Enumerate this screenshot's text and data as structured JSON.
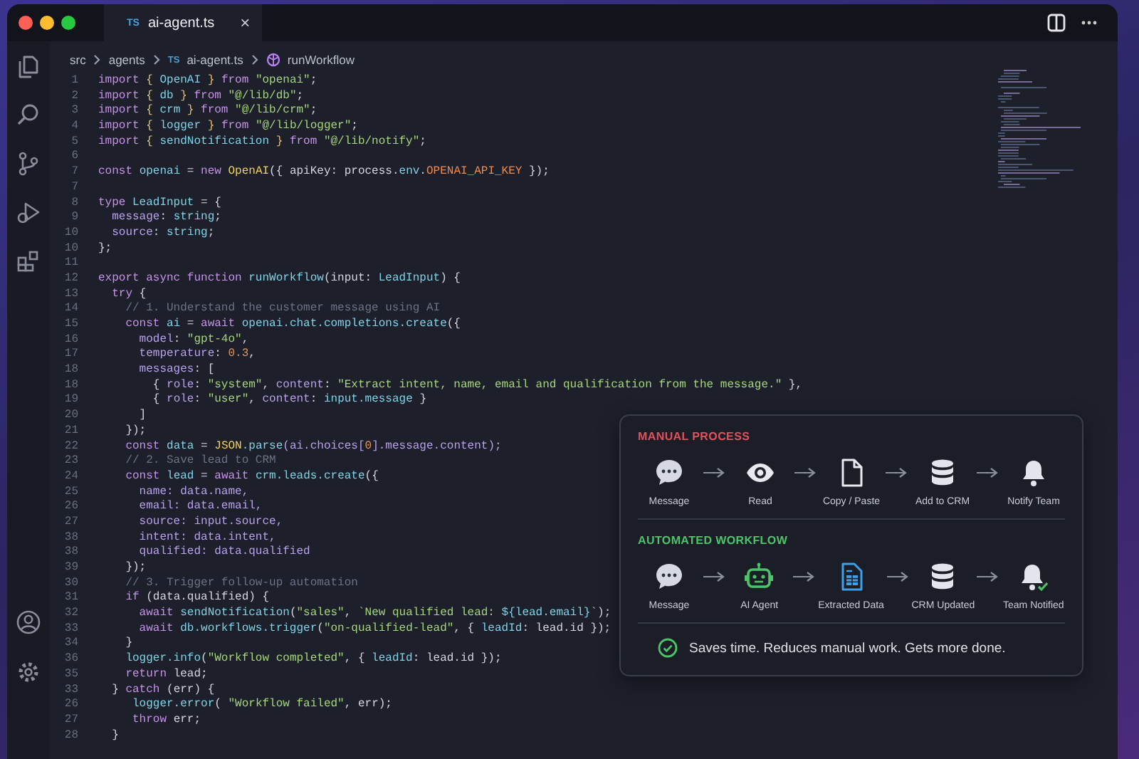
{
  "tab": {
    "badge": "TS",
    "title": "ai-agent.ts",
    "close": "×"
  },
  "breadcrumb": [
    {
      "kind": "folder",
      "label": "src"
    },
    {
      "kind": "folder",
      "label": "agents"
    },
    {
      "kind": "file",
      "badge": "TS",
      "label": "ai-agent.ts"
    },
    {
      "kind": "symbol",
      "label": "runWorkflow"
    }
  ],
  "code": [
    {
      "n": "1",
      "tokens": [
        {
          "t": "import",
          "kind": "kw"
        },
        {
          "t": " { ",
          "kind": "br"
        },
        {
          "t": "OpenAI",
          "kind": "id"
        },
        {
          "t": " } ",
          "kind": "br"
        },
        {
          "t": "from",
          "kind": "kw"
        },
        {
          "t": " \"openai\"",
          "kind": "str"
        },
        {
          "t": ";",
          "kind": "p"
        }
      ]
    },
    {
      "n": "2",
      "tokens": [
        {
          "t": "import",
          "kind": "kw"
        },
        {
          "t": " { ",
          "kind": "br"
        },
        {
          "t": "db",
          "kind": "id"
        },
        {
          "t": " } ",
          "kind": "br"
        },
        {
          "t": "from",
          "kind": "kw"
        },
        {
          "t": " \"@/lib/db\"",
          "kind": "str"
        },
        {
          "t": ";",
          "kind": "p"
        }
      ]
    },
    {
      "n": "3",
      "tokens": [
        {
          "t": "import",
          "kind": "kw"
        },
        {
          "t": " { ",
          "kind": "br"
        },
        {
          "t": "crm",
          "kind": "id"
        },
        {
          "t": " } ",
          "kind": "br"
        },
        {
          "t": "from",
          "kind": "kw"
        },
        {
          "t": " \"@/lib/crm\"",
          "kind": "str"
        },
        {
          "t": ";",
          "kind": "p"
        }
      ]
    },
    {
      "n": "4",
      "tokens": [
        {
          "t": "import",
          "kind": "kw"
        },
        {
          "t": " { ",
          "kind": "br"
        },
        {
          "t": "logger",
          "kind": "id"
        },
        {
          "t": " } ",
          "kind": "br"
        },
        {
          "t": "from",
          "kind": "kw"
        },
        {
          "t": " \"@/lib/logger\"",
          "kind": "str"
        },
        {
          "t": ";",
          "kind": "p"
        }
      ]
    },
    {
      "n": "5",
      "tokens": [
        {
          "t": "import",
          "kind": "kw"
        },
        {
          "t": " { ",
          "kind": "br"
        },
        {
          "t": "sendNotification",
          "kind": "id"
        },
        {
          "t": " } ",
          "kind": "br"
        },
        {
          "t": "from",
          "kind": "kw"
        },
        {
          "t": " \"@/lib/notify\"",
          "kind": "str"
        },
        {
          "t": ";",
          "kind": "p"
        }
      ]
    },
    {
      "n": "6"
    },
    {
      "n": "7",
      "tokens": [
        {
          "t": "const",
          "kind": "kw"
        },
        {
          "t": " openai",
          "kind": "id"
        },
        {
          "t": " = ",
          "kind": "p"
        },
        {
          "t": "new",
          "kind": "kw"
        },
        {
          "t": " OpenAI",
          "kind": "cls"
        },
        {
          "t": "({ apiKey: process.",
          "kind": "p"
        },
        {
          "t": "env",
          "kind": "id"
        },
        {
          "t": ".",
          "kind": "p"
        },
        {
          "t": "OPENAI_API_KEY",
          "kind": "cn"
        },
        {
          "t": " });",
          "kind": "p"
        }
      ]
    },
    {
      "n": "7"
    },
    {
      "n": "8",
      "tokens": [
        {
          "t": "type",
          "kind": "kw"
        },
        {
          "t": " LeadInput",
          "kind": "id"
        },
        {
          "t": " = {",
          "kind": "p"
        }
      ]
    },
    {
      "n": "9",
      "tokens": [
        {
          "t": "  message",
          "kind": "prop"
        },
        {
          "t": ": ",
          "kind": "p"
        },
        {
          "t": "string",
          "kind": "id"
        },
        {
          "t": ";",
          "kind": "p"
        }
      ]
    },
    {
      "n": "10",
      "tokens": [
        {
          "t": "  source",
          "kind": "prop"
        },
        {
          "t": ": ",
          "kind": "p"
        },
        {
          "t": "string",
          "kind": "id"
        },
        {
          "t": ";",
          "kind": "p"
        }
      ]
    },
    {
      "n": "10",
      "tokens": [
        {
          "t": "};",
          "kind": "p"
        }
      ]
    },
    {
      "n": "11"
    },
    {
      "n": "12",
      "tokens": [
        {
          "t": "export async function",
          "kind": "kw"
        },
        {
          "t": " runWorkflow",
          "kind": "id"
        },
        {
          "t": "(input: ",
          "kind": "p"
        },
        {
          "t": "LeadInput",
          "kind": "id"
        },
        {
          "t": ") {",
          "kind": "p"
        }
      ]
    },
    {
      "n": "13",
      "tokens": [
        {
          "t": "  try",
          "kind": "kw"
        },
        {
          "t": " {",
          "kind": "p"
        }
      ]
    },
    {
      "n": "14",
      "tokens": [
        {
          "t": "    // 1. Understand the customer message using AI",
          "kind": "com"
        }
      ]
    },
    {
      "n": "15",
      "tokens": [
        {
          "t": "    const",
          "kind": "kw"
        },
        {
          "t": " ai",
          "kind": "id"
        },
        {
          "t": " = ",
          "kind": "p"
        },
        {
          "t": "await",
          "kind": "kw"
        },
        {
          "t": " openai.chat.completions.create",
          "kind": "id"
        },
        {
          "t": "({",
          "kind": "p"
        }
      ]
    },
    {
      "n": "16",
      "tokens": [
        {
          "t": "      model",
          "kind": "prop"
        },
        {
          "t": ": ",
          "kind": "p"
        },
        {
          "t": "\"gpt-4o\"",
          "kind": "str"
        },
        {
          "t": ",",
          "kind": "p"
        }
      ]
    },
    {
      "n": "17",
      "tokens": [
        {
          "t": "      temperature",
          "kind": "prop"
        },
        {
          "t": ": ",
          "kind": "p"
        },
        {
          "t": "0.3",
          "kind": "num"
        },
        {
          "t": ",",
          "kind": "p"
        }
      ]
    },
    {
      "n": "18",
      "tokens": [
        {
          "t": "      messages",
          "kind": "prop"
        },
        {
          "t": ": [",
          "kind": "p"
        }
      ]
    },
    {
      "n": "18",
      "tokens": [
        {
          "t": "        { ",
          "kind": "p"
        },
        {
          "t": "role",
          "kind": "prop"
        },
        {
          "t": ": ",
          "kind": "p"
        },
        {
          "t": "\"system\"",
          "kind": "str"
        },
        {
          "t": ", ",
          "kind": "p"
        },
        {
          "t": "content",
          "kind": "prop"
        },
        {
          "t": ": ",
          "kind": "p"
        },
        {
          "t": "\"Extract intent, name, email and qualification from the message.\"",
          "kind": "str"
        },
        {
          "t": " },",
          "kind": "p"
        }
      ]
    },
    {
      "n": "19",
      "tokens": [
        {
          "t": "        { ",
          "kind": "p"
        },
        {
          "t": "role",
          "kind": "prop"
        },
        {
          "t": ": ",
          "kind": "p"
        },
        {
          "t": "\"user\"",
          "kind": "str"
        },
        {
          "t": ", ",
          "kind": "p"
        },
        {
          "t": "content",
          "kind": "prop"
        },
        {
          "t": ": ",
          "kind": "p"
        },
        {
          "t": "input.message",
          "kind": "id"
        },
        {
          "t": " }",
          "kind": "p"
        }
      ]
    },
    {
      "n": "20",
      "tokens": [
        {
          "t": "      ]",
          "kind": "p"
        }
      ]
    },
    {
      "n": "21",
      "tokens": [
        {
          "t": "    });",
          "kind": "p"
        }
      ]
    },
    {
      "n": "22",
      "tokens": [
        {
          "t": "    const",
          "kind": "kw"
        },
        {
          "t": " data",
          "kind": "id"
        },
        {
          "t": " = ",
          "kind": "p"
        },
        {
          "t": "JSON",
          "kind": "cls"
        },
        {
          "t": ".parse",
          "kind": "id"
        },
        {
          "t": "(ai.choices[",
          "kind": "prop"
        },
        {
          "t": "0",
          "kind": "num"
        },
        {
          "t": "].message.content);",
          "kind": "prop"
        }
      ]
    },
    {
      "n": "23",
      "tokens": [
        {
          "t": "    // 2. Save lead to CRM",
          "kind": "com"
        }
      ]
    },
    {
      "n": "24",
      "tokens": [
        {
          "t": "    const",
          "kind": "kw"
        },
        {
          "t": " lead",
          "kind": "id"
        },
        {
          "t": " = ",
          "kind": "p"
        },
        {
          "t": "await",
          "kind": "kw"
        },
        {
          "t": " crm.leads.create",
          "kind": "id"
        },
        {
          "t": "({",
          "kind": "p"
        }
      ]
    },
    {
      "n": "25",
      "tokens": [
        {
          "t": "      name",
          "kind": "prop"
        },
        {
          "t": ": data.name,",
          "kind": "prop"
        }
      ]
    },
    {
      "n": "26",
      "tokens": [
        {
          "t": "      email",
          "kind": "prop"
        },
        {
          "t": ": data.email,",
          "kind": "prop"
        }
      ]
    },
    {
      "n": "27",
      "tokens": [
        {
          "t": "      source",
          "kind": "prop"
        },
        {
          "t": ": input.source,",
          "kind": "prop"
        }
      ]
    },
    {
      "n": "38",
      "tokens": [
        {
          "t": "      intent",
          "kind": "prop"
        },
        {
          "t": ": data.intent,",
          "kind": "prop"
        }
      ]
    },
    {
      "n": "38",
      "tokens": [
        {
          "t": "      qualified",
          "kind": "prop"
        },
        {
          "t": ": data.qualified",
          "kind": "prop"
        }
      ]
    },
    {
      "n": "39",
      "tokens": [
        {
          "t": "    });",
          "kind": "p"
        }
      ]
    },
    {
      "n": "30",
      "tokens": [
        {
          "t": "    // 3. Trigger follow-up automation",
          "kind": "com"
        }
      ]
    },
    {
      "n": "31",
      "tokens": [
        {
          "t": "    if",
          "kind": "kw"
        },
        {
          "t": " (data.qualified) {",
          "kind": "p"
        }
      ]
    },
    {
      "n": "32",
      "tokens": [
        {
          "t": "      await",
          "kind": "kw"
        },
        {
          "t": " sendNotification",
          "kind": "id"
        },
        {
          "t": "(",
          "kind": "p"
        },
        {
          "t": "\"sales\"",
          "kind": "str"
        },
        {
          "t": ", ",
          "kind": "p"
        },
        {
          "t": "`New qualified lead: ",
          "kind": "str"
        },
        {
          "t": "${lead.email}",
          "kind": "id"
        },
        {
          "t": "`);",
          "kind": "p"
        }
      ]
    },
    {
      "n": "33",
      "tokens": [
        {
          "t": "      await",
          "kind": "kw"
        },
        {
          "t": " db.workflows.trigger",
          "kind": "id"
        },
        {
          "t": "(",
          "kind": "p"
        },
        {
          "t": "\"on-qualified-lead\"",
          "kind": "str"
        },
        {
          "t": ", { ",
          "kind": "p"
        },
        {
          "t": "leadId",
          "kind": "id"
        },
        {
          "t": ": lead.id });",
          "kind": "p"
        }
      ]
    },
    {
      "n": "34",
      "tokens": [
        {
          "t": "    }",
          "kind": "p"
        }
      ]
    },
    {
      "n": "36",
      "tokens": [
        {
          "t": "    logger.info",
          "kind": "id"
        },
        {
          "t": "(",
          "kind": "p"
        },
        {
          "t": "\"Workflow completed\"",
          "kind": "str"
        },
        {
          "t": ", { ",
          "kind": "p"
        },
        {
          "t": "leadId",
          "kind": "id"
        },
        {
          "t": ": lead.id });",
          "kind": "p"
        }
      ]
    },
    {
      "n": "35",
      "tokens": [
        {
          "t": "    return",
          "kind": "kw"
        },
        {
          "t": " lead;",
          "kind": "p"
        }
      ]
    },
    {
      "n": "33",
      "tokens": [
        {
          "t": "  } ",
          "kind": "p"
        },
        {
          "t": "catch",
          "kind": "kw"
        },
        {
          "t": " (err) {",
          "kind": "p"
        }
      ]
    },
    {
      "n": "26",
      "tokens": [
        {
          "t": "     logger.error",
          "kind": "id"
        },
        {
          "t": "( ",
          "kind": "p"
        },
        {
          "t": "\"Workflow failed\"",
          "kind": "str"
        },
        {
          "t": ", err);",
          "kind": "p"
        }
      ]
    },
    {
      "n": "27",
      "tokens": [
        {
          "t": "     throw",
          "kind": "kw"
        },
        {
          "t": " err;",
          "kind": "p"
        }
      ]
    },
    {
      "n": "28",
      "tokens": [
        {
          "t": "  }",
          "kind": "p"
        }
      ]
    }
  ],
  "panel": {
    "sections": [
      {
        "title": "MANUAL PROCESS",
        "color": "#e0525c",
        "steps": [
          {
            "kind": "chat",
            "label": "Message"
          },
          {
            "kind": "eye",
            "label": "Read"
          },
          {
            "kind": "page",
            "label": "Copy / Paste"
          },
          {
            "kind": "database",
            "label": "Add to CRM"
          },
          {
            "kind": "bell",
            "label": "Notify Team"
          }
        ]
      },
      {
        "title": "AUTOMATED WORKFLOW",
        "color": "#4cc46a",
        "steps": [
          {
            "kind": "chat",
            "label": "Message"
          },
          {
            "kind": "robot",
            "label": "AI Agent"
          },
          {
            "kind": "sheet",
            "label": "Extracted Data"
          },
          {
            "kind": "database",
            "label": "CRM Updated"
          },
          {
            "kind": "bell-check",
            "label": "Team Notified"
          }
        ]
      }
    ],
    "footer": "Saves time. Reduces manual work. Gets more done."
  }
}
